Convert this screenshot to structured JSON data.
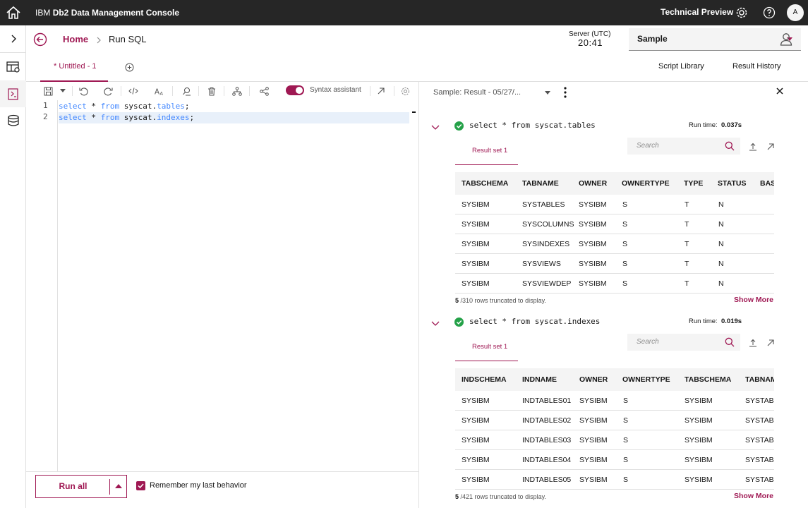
{
  "header": {
    "brand_prefix": "IBM",
    "brand_name": "Db2 Data Management Console",
    "tech_preview": "Technical Preview",
    "avatar_initial": "A"
  },
  "breadcrumb": {
    "home": "Home",
    "current": "Run SQL"
  },
  "server": {
    "label": "Server (UTC)",
    "time": "20:41"
  },
  "database_select": {
    "value": "Sample"
  },
  "tabs": {
    "editor_tab": "* Untitled - 1",
    "script_library": "Script Library",
    "result_history": "Result History"
  },
  "toolbar": {
    "syntax_assistant": "Syntax assistant"
  },
  "editor": {
    "lines": [
      {
        "num": "1",
        "kw1": "select",
        "star": " * ",
        "kw2": "from",
        "schema": " syscat.",
        "table": "tables",
        "end": ";"
      },
      {
        "num": "2",
        "kw1": "select",
        "star": " * ",
        "kw2": "from",
        "schema": " syscat.",
        "table": "indexes",
        "end": ";"
      }
    ]
  },
  "footer": {
    "run_all": "Run all",
    "remember": "Remember my last behavior"
  },
  "results": {
    "title": "Sample: Result - 05/27/...",
    "blocks": [
      {
        "query": "select * from syscat.tables",
        "run_time_label": "Run time:",
        "run_time": "0.037s",
        "result_set": "Result set 1",
        "search_placeholder": "Search",
        "columns": [
          "TABSCHEMA",
          "TABNAME",
          "OWNER",
          "OWNERTYPE",
          "TYPE",
          "STATUS",
          "BAS"
        ],
        "rows": [
          [
            "SYSIBM",
            "SYSTABLES",
            "SYSIBM",
            "S",
            "T",
            "N"
          ],
          [
            "SYSIBM",
            "SYSCOLUMNS",
            "SYSIBM",
            "S",
            "T",
            "N"
          ],
          [
            "SYSIBM",
            "SYSINDEXES",
            "SYSIBM",
            "S",
            "T",
            "N"
          ],
          [
            "SYSIBM",
            "SYSVIEWS",
            "SYSIBM",
            "S",
            "T",
            "N"
          ],
          [
            "SYSIBM",
            "SYSVIEWDEP",
            "SYSIBM",
            "S",
            "T",
            "N"
          ]
        ],
        "shown": "5",
        "total_text": " /310 rows truncated to display.",
        "show_more": "Show More"
      },
      {
        "query": "select * from syscat.indexes",
        "run_time_label": "Run time:",
        "run_time": "0.019s",
        "result_set": "Result set 1",
        "search_placeholder": "Search",
        "columns": [
          "INDSCHEMA",
          "INDNAME",
          "OWNER",
          "OWNERTYPE",
          "TABSCHEMA",
          "TABNAM"
        ],
        "rows": [
          [
            "SYSIBM",
            "INDTABLES01",
            "SYSIBM",
            "S",
            "SYSIBM",
            "SYSTAB"
          ],
          [
            "SYSIBM",
            "INDTABLES02",
            "SYSIBM",
            "S",
            "SYSIBM",
            "SYSTAB"
          ],
          [
            "SYSIBM",
            "INDTABLES03",
            "SYSIBM",
            "S",
            "SYSIBM",
            "SYSTAB"
          ],
          [
            "SYSIBM",
            "INDTABLES04",
            "SYSIBM",
            "S",
            "SYSIBM",
            "SYSTAB"
          ],
          [
            "SYSIBM",
            "INDTABLES05",
            "SYSIBM",
            "S",
            "SYSIBM",
            "SYSTAB"
          ]
        ],
        "shown": "5",
        "total_text": " /421 rows truncated to display.",
        "show_more": "Show More"
      }
    ]
  },
  "colors": {
    "accent": "#9f1853",
    "header_bg": "#262626",
    "success": "#24a148",
    "keyword": "#4589ff"
  },
  "icons": {
    "rail": [
      "home-icon",
      "expand-icon",
      "table-explore-icon",
      "sql-editor-icon",
      "database-icon"
    ],
    "toolbar": [
      "save-icon",
      "undo-icon",
      "redo-icon",
      "format-code-icon",
      "font-size-icon",
      "explain-icon",
      "delete-icon",
      "hierarchy-icon",
      "share-icon",
      "external-link-icon",
      "settings-icon"
    ]
  }
}
